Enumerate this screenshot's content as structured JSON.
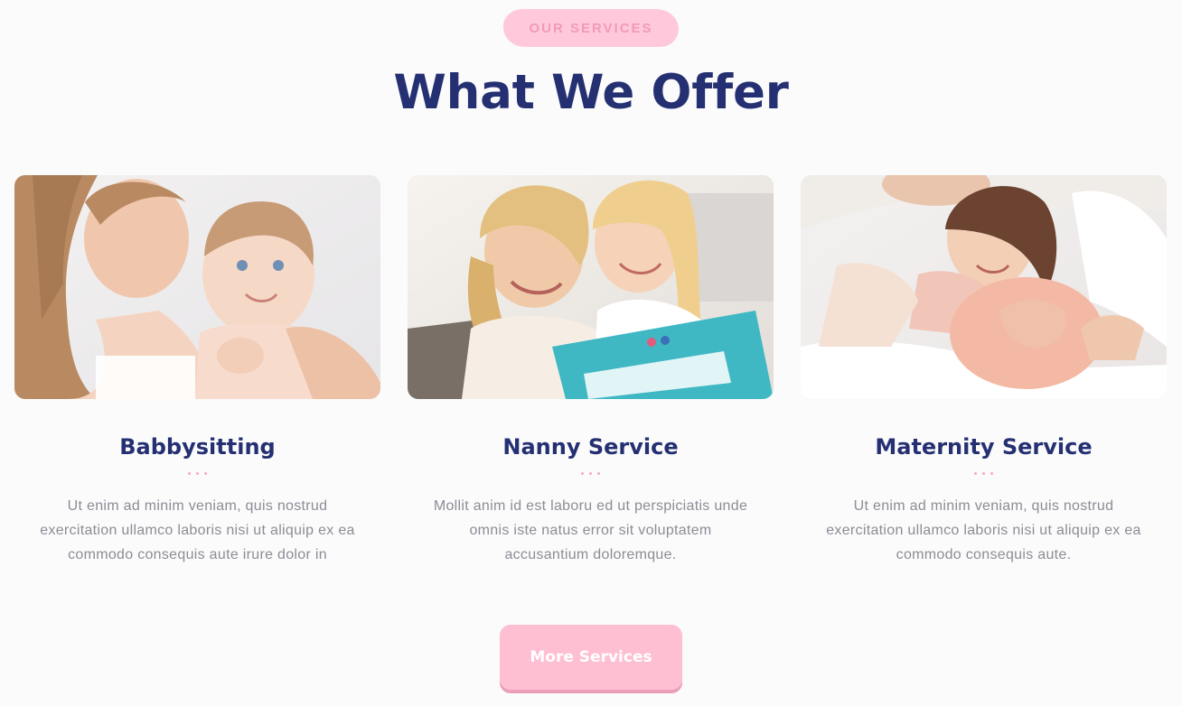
{
  "header": {
    "eyebrow": "OUR SERVICES",
    "title": "What We Offer"
  },
  "services": [
    {
      "title": "Babbysitting",
      "text": "Ut enim ad minim veniam, quis nostrud exercitation ullamco laboris nisi ut aliquip ex ea commodo consequis aute irure dolor in"
    },
    {
      "title": "Nanny Service",
      "text": "Mollit anim id est laboru ed ut perspiciatis unde omnis iste natus error sit voluptatem accusantium doloremque."
    },
    {
      "title": "Maternity Service",
      "text": "Ut enim ad minim veniam, quis nostrud exercitation ullamco laboris nisi ut aliquip ex ea commodo consequis aute."
    }
  ],
  "cta": {
    "label": "More Services"
  },
  "colors": {
    "navy": "#253072",
    "pink": "#ffbfd3",
    "pink_text": "#f19ab9",
    "muted_text": "#8c8c95",
    "background": "#fbfbfc"
  }
}
